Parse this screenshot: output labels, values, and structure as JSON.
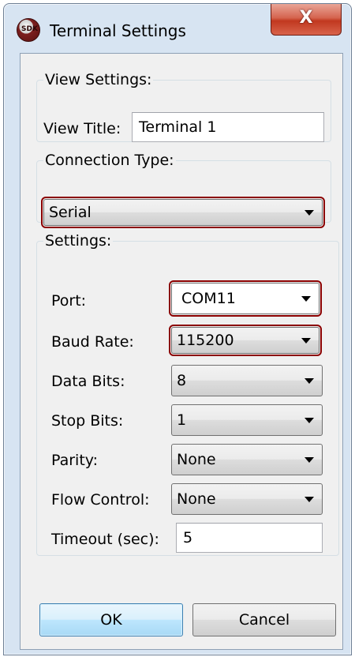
{
  "window": {
    "title": "Terminal Settings",
    "close_label": "X"
  },
  "view_settings": {
    "legend": "View Settings:",
    "title_label": "View Title:",
    "title_value": "Terminal 1"
  },
  "connection": {
    "legend": "Connection Type:",
    "type_value": "Serial"
  },
  "settings": {
    "legend": "Settings:",
    "port_label": "Port:",
    "port_value": "COM11",
    "baud_label": "Baud Rate:",
    "baud_value": "115200",
    "databits_label": "Data Bits:",
    "databits_value": "8",
    "stopbits_label": "Stop Bits:",
    "stopbits_value": "1",
    "parity_label": "Parity:",
    "parity_value": "None",
    "flow_label": "Flow Control:",
    "flow_value": "None",
    "timeout_label": "Timeout (sec):",
    "timeout_value": "5"
  },
  "buttons": {
    "ok": "OK",
    "cancel": "Cancel"
  },
  "colors": {
    "highlight": "#8b0000",
    "close_button": "#c1381f",
    "window_frame": "#d7e4f2"
  },
  "icons": [
    "sdk-app-icon",
    "close-icon",
    "dropdown-arrow-icon"
  ]
}
